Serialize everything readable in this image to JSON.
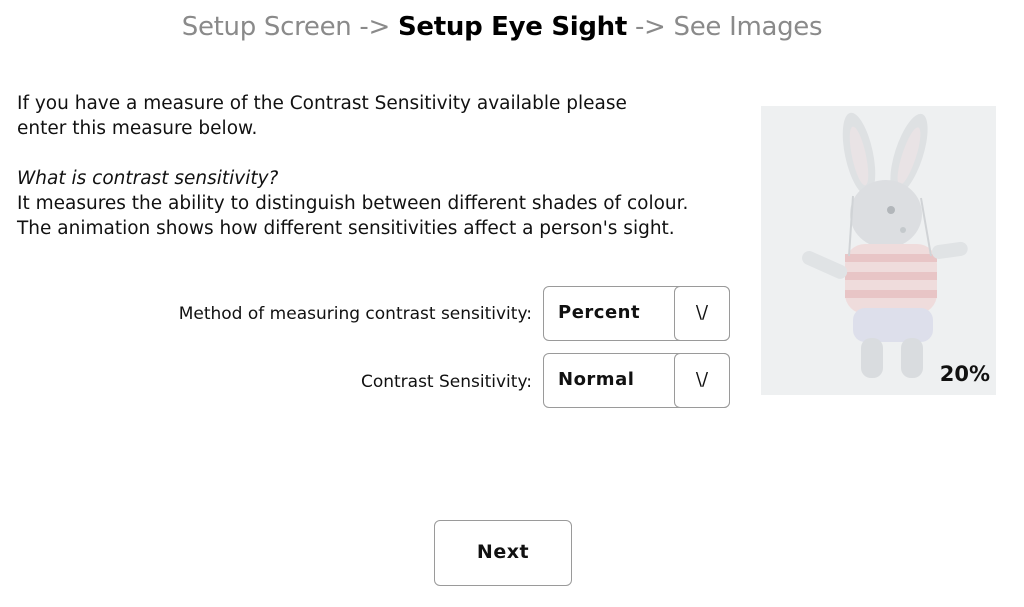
{
  "breadcrumb": {
    "step1": "Setup Screen",
    "sep1": " -> ",
    "step2": "Setup Eye Sight",
    "sep2": " -> ",
    "step3": "See Images"
  },
  "intro": {
    "line1": "If you have a measure of the Contrast Sensitivity available please",
    "line2": "enter this measure below.",
    "question": "What is contrast sensitivity?",
    "answer1": "It measures the ability to distinguish between different shades of colour.",
    "answer2": "The animation shows how different sensitivities affect a person's sight."
  },
  "method": {
    "label": "Method of measuring contrast sensitivity:",
    "value": "Percent",
    "arrow": "\\/"
  },
  "sensitivity": {
    "label": "Contrast Sensitivity:",
    "value": "Normal",
    "arrow": "\\/"
  },
  "preview": {
    "percent": "20%"
  },
  "next_label": "Next",
  "colors": {
    "inactive_text": "#8a8a8a",
    "border": "#9a9a9a"
  }
}
